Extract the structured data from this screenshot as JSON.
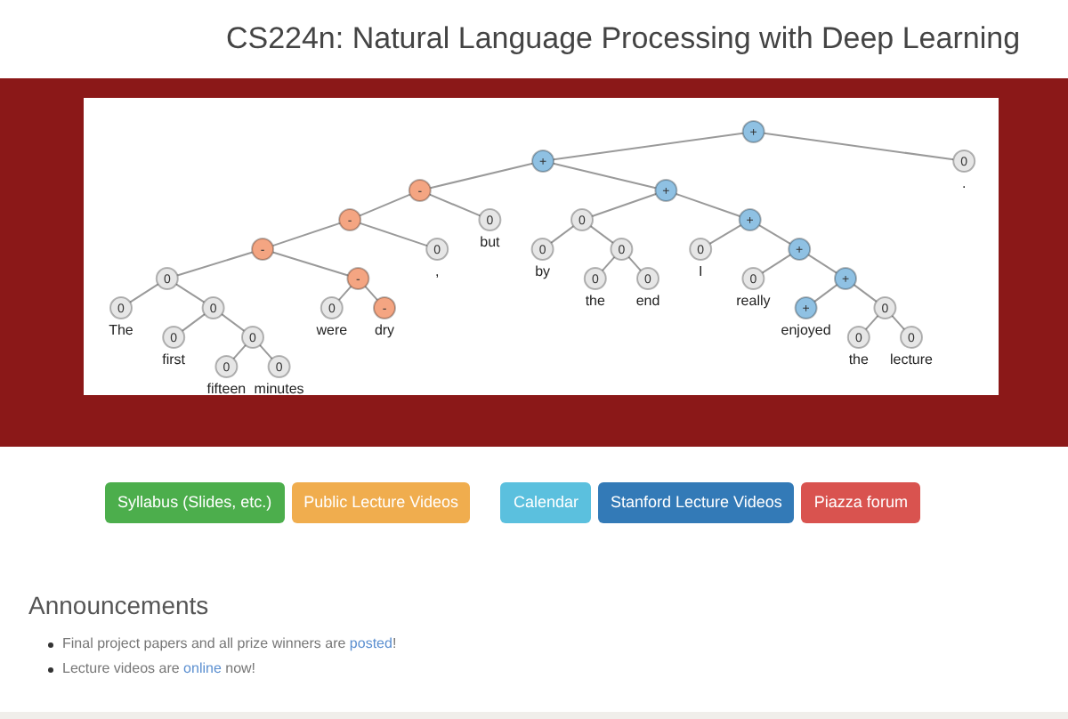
{
  "page_title": "CS224n: Natural Language Processing with Deep Learning",
  "sentiment_tree": {
    "label": "+",
    "color": "#8fc1e3",
    "children": [
      {
        "label": "+",
        "color": "#8fc1e3",
        "children": [
          {
            "label": "-",
            "color": "#f4a582",
            "children": [
              {
                "label": "-",
                "color": "#f4a582",
                "children": [
                  {
                    "label": "-",
                    "color": "#f4a582",
                    "children": [
                      {
                        "label": "0",
                        "color": "#e6e6e6",
                        "children": [
                          {
                            "label": "0",
                            "color": "#e6e6e6",
                            "word": "The"
                          },
                          {
                            "label": "0",
                            "color": "#e6e6e6",
                            "children": [
                              {
                                "label": "0",
                                "color": "#e6e6e6",
                                "word": "first"
                              },
                              {
                                "label": "0",
                                "color": "#e6e6e6",
                                "children": [
                                  {
                                    "label": "0",
                                    "color": "#e6e6e6",
                                    "word": "fifteen"
                                  },
                                  {
                                    "label": "0",
                                    "color": "#e6e6e6",
                                    "word": "minutes"
                                  }
                                ]
                              }
                            ]
                          }
                        ]
                      },
                      {
                        "label": "-",
                        "color": "#f4a582",
                        "children": [
                          {
                            "label": "0",
                            "color": "#e6e6e6",
                            "word": "were"
                          },
                          {
                            "label": "-",
                            "color": "#f4a582",
                            "word": "dry"
                          }
                        ]
                      }
                    ]
                  },
                  {
                    "label": "0",
                    "color": "#e6e6e6",
                    "word": ","
                  }
                ]
              },
              {
                "label": "0",
                "color": "#e6e6e6",
                "word": "but"
              }
            ]
          },
          {
            "label": "+",
            "color": "#8fc1e3",
            "children": [
              {
                "label": "0",
                "color": "#e6e6e6",
                "children": [
                  {
                    "label": "0",
                    "color": "#e6e6e6",
                    "word": "by"
                  },
                  {
                    "label": "0",
                    "color": "#e6e6e6",
                    "children": [
                      {
                        "label": "0",
                        "color": "#e6e6e6",
                        "word": "the"
                      },
                      {
                        "label": "0",
                        "color": "#e6e6e6",
                        "word": "end"
                      }
                    ]
                  }
                ]
              },
              {
                "label": "+",
                "color": "#8fc1e3",
                "children": [
                  {
                    "label": "0",
                    "color": "#e6e6e6",
                    "word": "I"
                  },
                  {
                    "label": "+",
                    "color": "#8fc1e3",
                    "children": [
                      {
                        "label": "0",
                        "color": "#e6e6e6",
                        "word": "really"
                      },
                      {
                        "label": "+",
                        "color": "#8fc1e3",
                        "children": [
                          {
                            "label": "+",
                            "color": "#8fc1e3",
                            "word": "enjoyed"
                          },
                          {
                            "label": "0",
                            "color": "#e6e6e6",
                            "children": [
                              {
                                "label": "0",
                                "color": "#e6e6e6",
                                "word": "the"
                              },
                              {
                                "label": "0",
                                "color": "#e6e6e6",
                                "word": "lecture"
                              }
                            ]
                          }
                        ]
                      }
                    ]
                  }
                ]
              }
            ]
          }
        ]
      },
      {
        "label": "0",
        "color": "#e6e6e6",
        "word": "."
      }
    ]
  },
  "button_groups": [
    [
      {
        "label": "Syllabus (Slides, etc.)",
        "color": "#4cae4c"
      },
      {
        "label": "Public Lecture Videos",
        "color": "#f0ad4e"
      }
    ],
    [
      {
        "label": "Calendar",
        "color": "#5bc0de"
      },
      {
        "label": "Stanford Lecture Videos",
        "color": "#337ab7"
      },
      {
        "label": "Piazza forum",
        "color": "#d9534f"
      }
    ]
  ],
  "announcements": {
    "heading": "Announcements",
    "items": [
      {
        "text_before": "Final project papers and all prize winners are ",
        "link": "posted",
        "text_after": "!"
      },
      {
        "text_before": "Lecture videos are ",
        "link": "online",
        "text_after": " now!"
      }
    ]
  }
}
